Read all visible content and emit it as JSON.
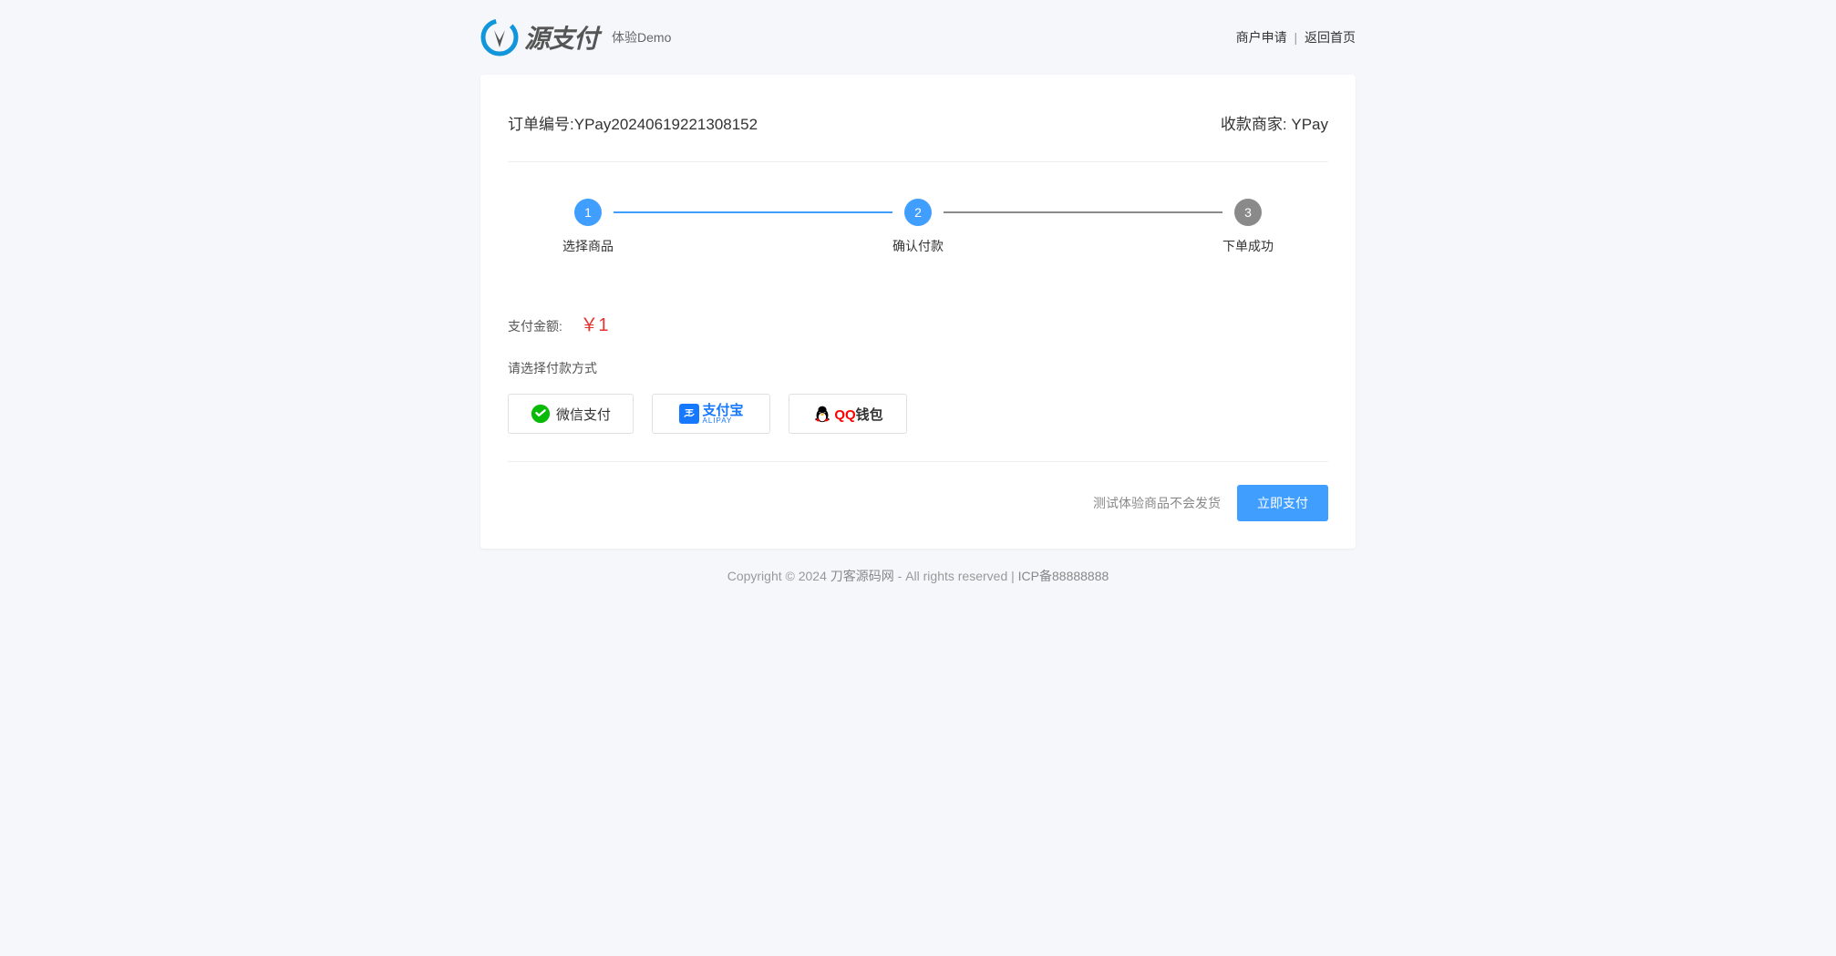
{
  "header": {
    "demo_label": "体验Demo",
    "merchant_apply": "商户申请",
    "return_home": "返回首页"
  },
  "order": {
    "order_no_label": "订单编号:",
    "order_no": "YPay20240619221308152",
    "merchant_label": "收款商家:",
    "merchant_name": "YPay"
  },
  "steps": {
    "step1_num": "1",
    "step1_label": "选择商品",
    "step2_num": "2",
    "step2_label": "确认付款",
    "step3_num": "3",
    "step3_label": "下单成功"
  },
  "payment": {
    "amount_label": "支付金额:",
    "amount_value": "￥1",
    "select_label": "请选择付款方式",
    "wechat_label": "微信支付",
    "alipay_cn": "支付宝",
    "alipay_en": "ALIPAY",
    "qq_q": "QQ",
    "qq_rest": "钱包"
  },
  "action": {
    "note": "测试体验商品不会发货",
    "pay_button": "立即支付"
  },
  "footer": {
    "copyright_prefix": "Copyright © 2024 ",
    "site_name": "刀客源码网",
    "rights": " - All rights reserved | ",
    "icp": "ICP备88888888"
  }
}
